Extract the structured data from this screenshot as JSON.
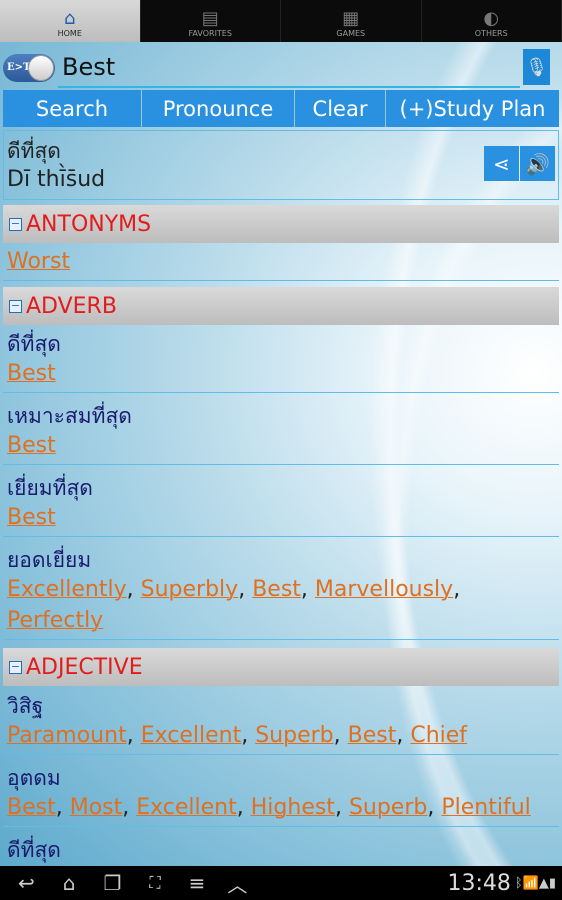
{
  "tabs": [
    {
      "label": "HOME",
      "icon": "home-icon",
      "active": true
    },
    {
      "label": "FAVORITES",
      "icon": "clipboard-icon"
    },
    {
      "label": "GAMES",
      "icon": "abacus-icon"
    },
    {
      "label": "OTHERS",
      "icon": "pie-icon"
    }
  ],
  "toggle": {
    "label": "E>T"
  },
  "search": {
    "value": "Best"
  },
  "buttons": {
    "search": "Search",
    "pronounce": "Pronounce",
    "clear": "Clear",
    "study": "(+)Study Plan"
  },
  "result": {
    "thai": "ดีที่สุด",
    "phonetic": "Dī thī̀s̄ud"
  },
  "sections": [
    {
      "title": "ANTONYMS",
      "entries": [
        {
          "words": [
            "Worst"
          ]
        }
      ]
    },
    {
      "title": "ADVERB",
      "entries": [
        {
          "thai": "ดีที่สุด",
          "words": [
            "Best"
          ]
        },
        {
          "thai": "เหมาะสมที่สุด",
          "words": [
            "Best"
          ]
        },
        {
          "thai": "เยี่ยมที่สุด",
          "words": [
            "Best"
          ]
        },
        {
          "thai": "ยอดเยี่ยม",
          "words": [
            "Excellently",
            "Superbly",
            "Best",
            "Marvellously",
            "Perfectly"
          ]
        }
      ]
    },
    {
      "title": "ADJECTIVE",
      "entries": [
        {
          "thai": "วิสิฐ",
          "words": [
            "Paramount",
            "Excellent",
            "Superb",
            "Best",
            "Chief"
          ]
        },
        {
          "thai": "อุตดม",
          "words": [
            "Best",
            "Most",
            "Excellent",
            "Highest",
            "Superb",
            "Plentiful"
          ]
        },
        {
          "thai": "ดีที่สุด",
          "words": []
        }
      ]
    }
  ],
  "status": {
    "time": "13:48"
  },
  "colors": {
    "accent": "#2a90e0",
    "link": "#e0701f",
    "section": "#e21c1c",
    "thai": "#1a1a6e"
  }
}
